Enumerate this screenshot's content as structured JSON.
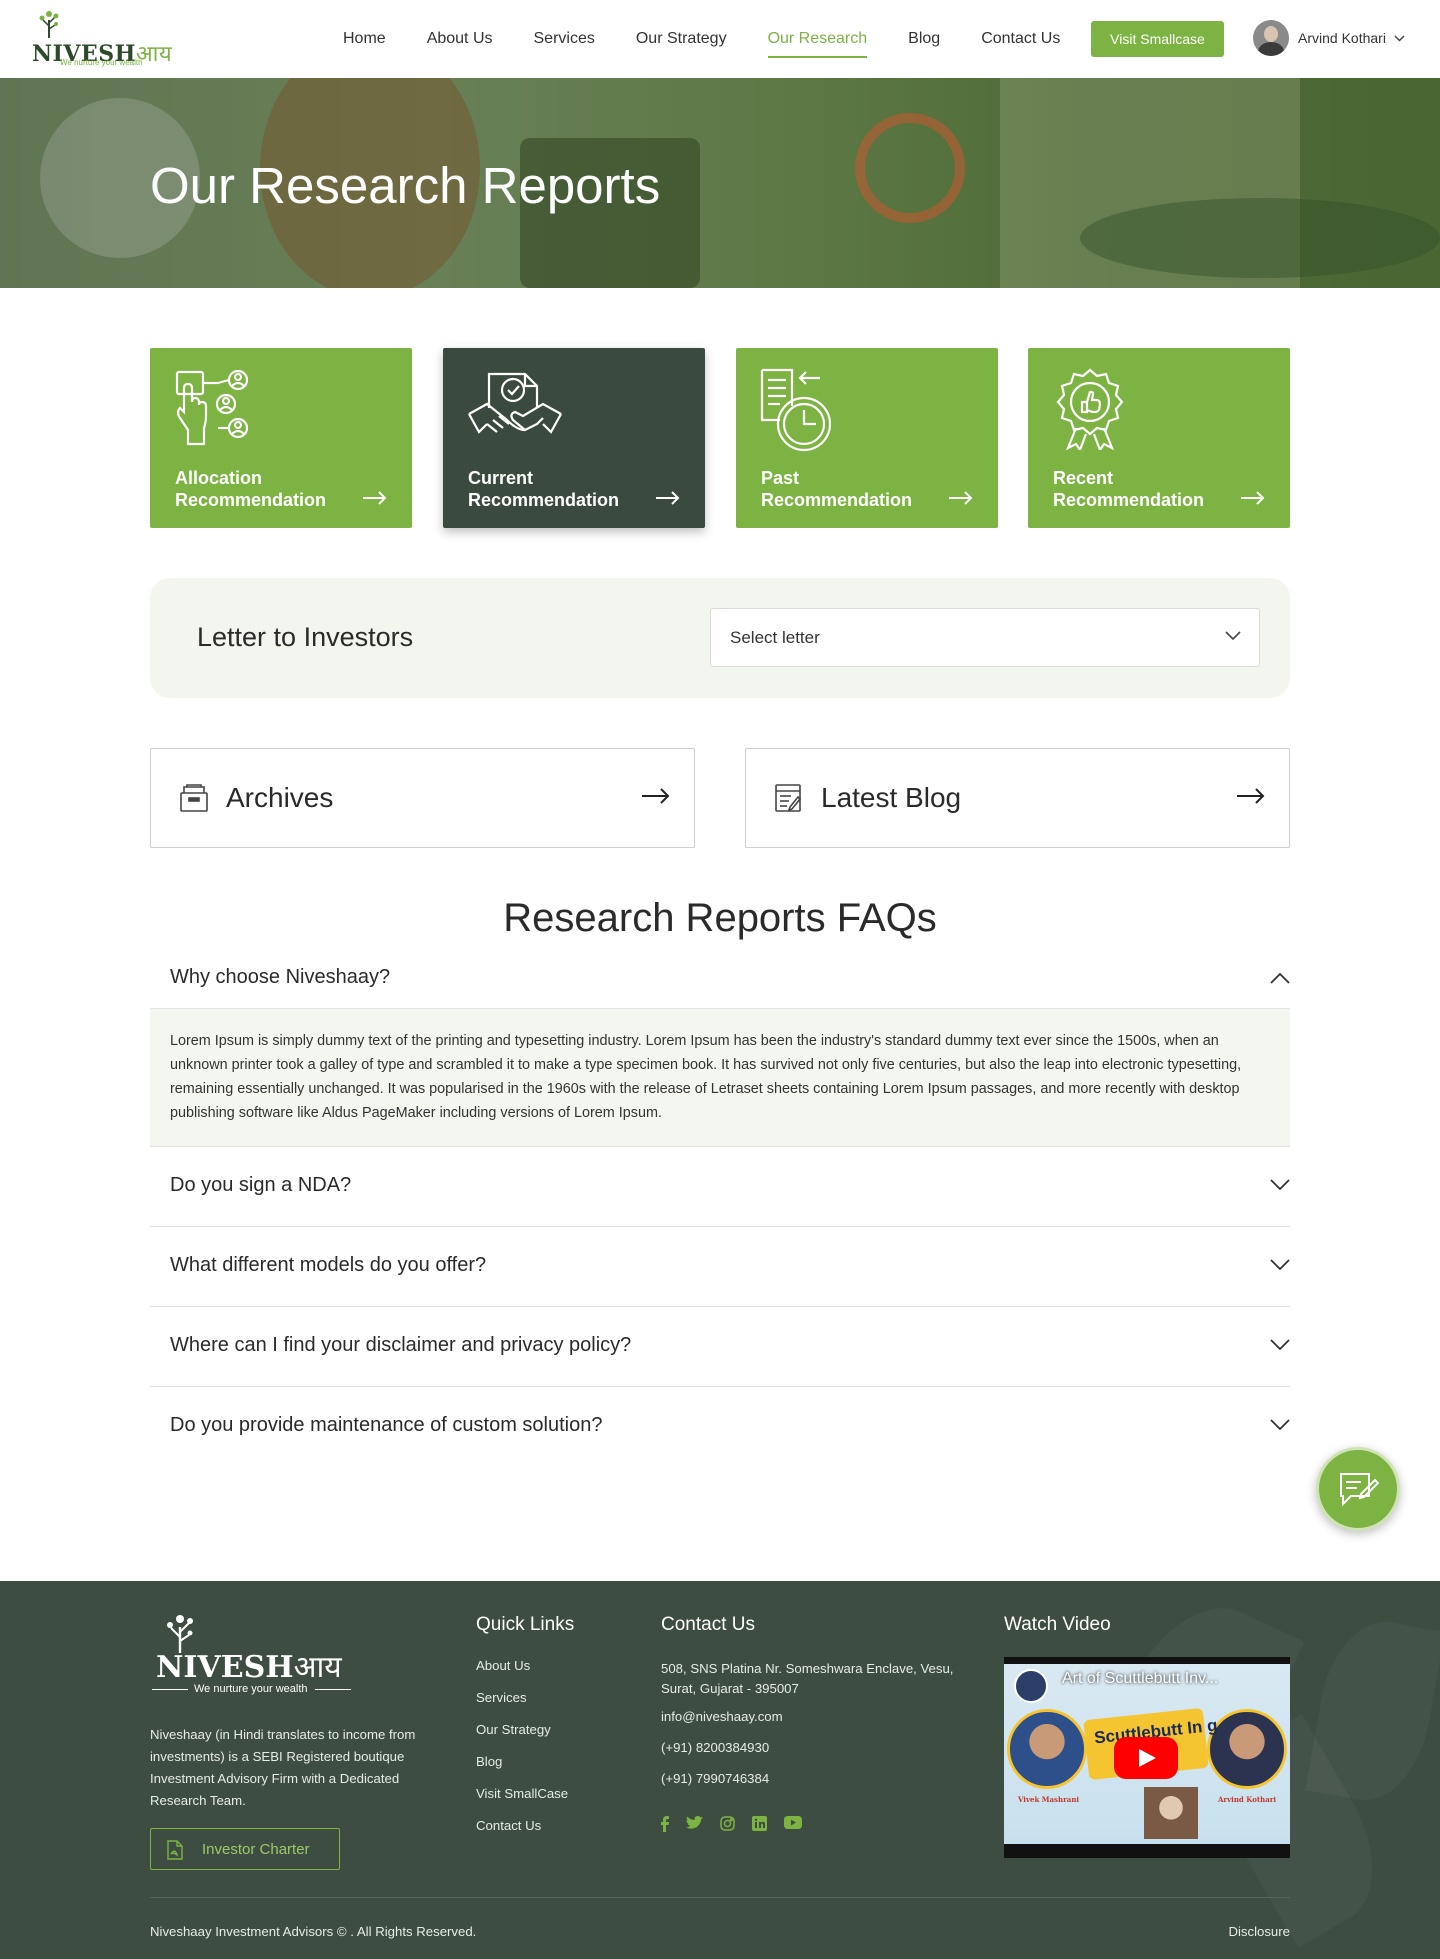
{
  "header": {
    "logo_text": "NIVESH",
    "logo_hindi": "आय",
    "logo_tagline": "We nurture your wealth",
    "nav": [
      "Home",
      "About Us",
      "Services",
      "Our Strategy",
      "Our Research",
      "Blog",
      "Contact Us"
    ],
    "active_nav": "Our Research",
    "cta_label": "Visit Smallcase",
    "user_name": "Arvind Kothari"
  },
  "hero": {
    "title": "Our Research Reports"
  },
  "cards": [
    {
      "label": "Allocation Recommendation",
      "icon": "allocation-icon",
      "selected": false
    },
    {
      "label": "Current Recommendation",
      "icon": "handshake-icon",
      "selected": true
    },
    {
      "label": "Past Recommendation",
      "icon": "history-document-icon",
      "selected": false
    },
    {
      "label": "Recent Recommendation",
      "icon": "award-badge-icon",
      "selected": false
    }
  ],
  "letter": {
    "title": "Letter to Investors",
    "select_placeholder": "Select letter"
  },
  "boxes": {
    "archives": "Archives",
    "latest_blog": "Latest Blog"
  },
  "faqs": {
    "title": "Research Reports FAQs",
    "items": [
      {
        "q": "Why choose Niveshaay?",
        "open": true,
        "a": "Lorem Ipsum is simply dummy text of the printing and typesetting industry. Lorem Ipsum has been the industry's standard dummy text ever since the 1500s, when an unknown printer took a galley of type and scrambled it to make a type specimen book. It has survived not only five centuries, but also the leap into electronic typesetting, remaining essentially unchanged. It was popularised in the 1960s with the release of Letraset sheets containing Lorem Ipsum passages, and more recently with desktop publishing software like Aldus PageMaker including versions of Lorem Ipsum."
      },
      {
        "q": "Do you sign a NDA?",
        "open": false
      },
      {
        "q": "What different models do you offer?",
        "open": false
      },
      {
        "q": "Where can I find your disclaimer and privacy policy?",
        "open": false
      },
      {
        "q": "Do you provide maintenance of custom solution?",
        "open": false
      }
    ]
  },
  "footer": {
    "logo_text": "NIVESH",
    "logo_hindi": "आय",
    "logo_tagline": "We nurture your wealth",
    "description": "Niveshaay (in Hindi translates to income from investments) is a SEBI Registered boutique Investment Advisory Firm with a Dedicated Research Team.",
    "charter_label": "Investor Charter",
    "quick_links_title": "Quick Links",
    "quick_links": [
      "About Us",
      "Services",
      "Our Strategy",
      "Blog",
      "Visit SmallCase",
      "Contact Us"
    ],
    "contact_title": "Contact Us",
    "address": "508, SNS Platina Nr. Someshwara Enclave, Vesu, Surat, Gujarat - 395007",
    "email": "info@niveshaay.com",
    "phone1": "(+91) 8200384930",
    "phone2": "(+91) 7990746384",
    "socials": [
      "facebook-icon",
      "twitter-icon",
      "instagram-icon",
      "linkedin-icon",
      "youtube-icon"
    ],
    "video_title": "Watch Video",
    "video_caption": "Art of Scuttlebutt Inv...",
    "video_thumb_text": "Scuttlebutt In  g",
    "video_person_left": "Vivek Mashrani",
    "video_person_right": "Arvind Kothari",
    "copyright": "Niveshaay Investment Advisors © . All Rights Reserved.",
    "disclosure": "Disclosure"
  },
  "colors": {
    "accent": "#7cb342",
    "dark_card": "#3b4a3e",
    "footer_bg": "#3d4d42",
    "letter_bg": "#f3f6ee"
  }
}
